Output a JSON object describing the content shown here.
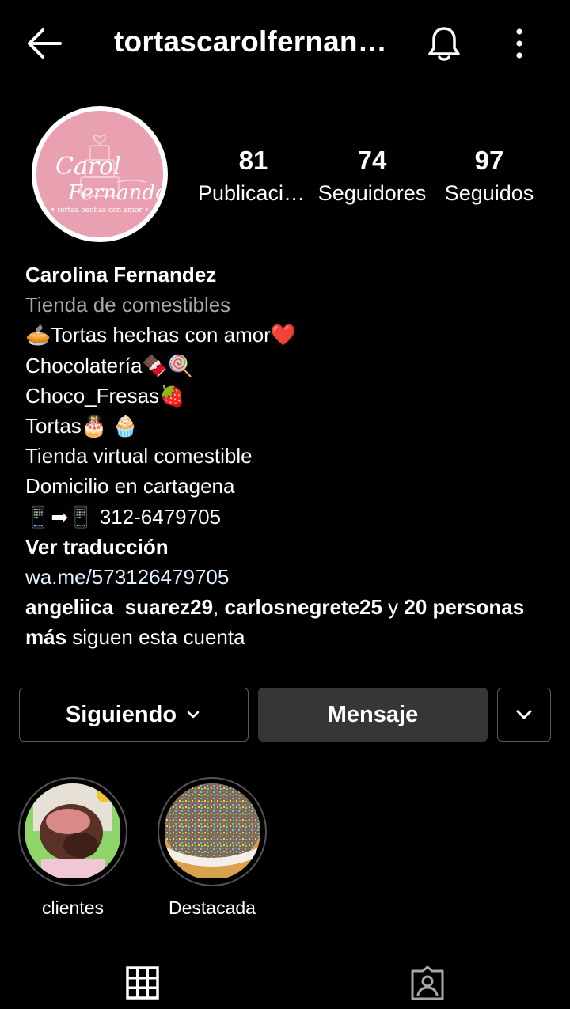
{
  "header": {
    "username": "tortascarolfernandez",
    "back_icon": "arrow-left-icon",
    "bell_icon": "bell-icon",
    "more_icon": "more-vertical-icon"
  },
  "profile": {
    "avatar_text": {
      "line1": "Carol",
      "line2": "Fernandez",
      "tagline": "• tortas hechas con amor •"
    },
    "stats": [
      {
        "number": "81",
        "label": "Publicaciones"
      },
      {
        "number": "74",
        "label": "Seguidores"
      },
      {
        "number": "97",
        "label": "Seguidos"
      }
    ]
  },
  "bio": {
    "name": "Carolina Fernandez",
    "category": "Tienda de comestibles",
    "lines": [
      "🥧Tortas hechas con amor❤️",
      "Chocolatería🍫🍭",
      "Choco_Fresas🍓",
      "Tortas🎂 🧁",
      "Tienda virtual comestible",
      "Domicilio en cartagena",
      "📱➡📱 312-6479705"
    ],
    "translate": "Ver traducción",
    "link": "wa.me/573126479705",
    "followed_by": {
      "user1": "angeliica_suarez29",
      "sep": ", ",
      "user2": "carlosnegrete25",
      "and": " y ",
      "others": "20 personas más",
      "suffix": " siguen esta cuenta"
    }
  },
  "actions": {
    "following_label": "Siguiendo",
    "message_label": "Mensaje"
  },
  "highlights": [
    {
      "label": "clientes"
    },
    {
      "label": "Destacada"
    }
  ],
  "tabs": [
    {
      "icon": "grid-icon",
      "active": true
    },
    {
      "icon": "tagged-icon",
      "active": false
    }
  ],
  "colors": {
    "background": "#000000",
    "text": "#ffffff",
    "secondary_text": "#a8a8a8",
    "message_button": "#363636",
    "avatar_pink": "#e9a0b1"
  }
}
